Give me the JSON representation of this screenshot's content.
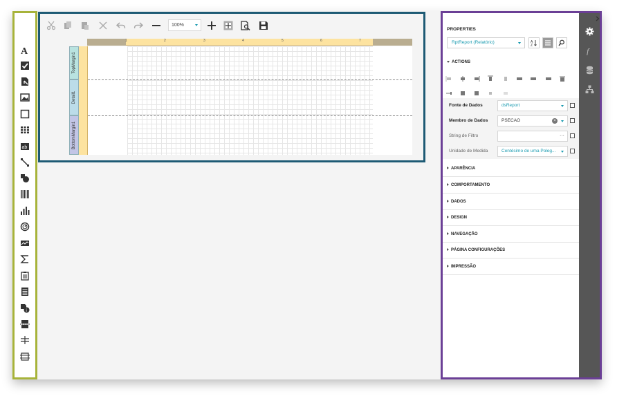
{
  "colors": {
    "toolbox_border": "#a7b33a",
    "surface_border": "#1d5a74",
    "props_border": "#6b3f96",
    "accent": "#1a9bb0",
    "ruler": "#fde3a0",
    "side_tabs": "#565656"
  },
  "toolbox": {
    "items": [
      {
        "icon": "label-icon"
      },
      {
        "icon": "checkbox-icon"
      },
      {
        "icon": "rich-text-icon"
      },
      {
        "icon": "picture-box-icon"
      },
      {
        "icon": "panel-icon"
      },
      {
        "icon": "table-icon"
      },
      {
        "icon": "character-comb-icon"
      },
      {
        "icon": "line-icon"
      },
      {
        "icon": "shape-icon"
      },
      {
        "icon": "barcode-icon"
      },
      {
        "icon": "chart-icon"
      },
      {
        "icon": "gauge-icon"
      },
      {
        "icon": "sparkline-icon"
      },
      {
        "icon": "sum-icon"
      },
      {
        "icon": "subreport-icon"
      },
      {
        "icon": "pivot-grid-icon"
      },
      {
        "icon": "page-info-icon"
      },
      {
        "icon": "page-break-icon"
      },
      {
        "icon": "cross-band-line-icon"
      },
      {
        "icon": "cross-band-box-icon"
      }
    ]
  },
  "surface": {
    "toolbar": {
      "zoom_value": "100%",
      "buttons": [
        "cut-icon",
        "copy-icon",
        "paste-icon",
        "delete-icon",
        "undo-icon",
        "redo-icon",
        "zoom-out-icon",
        "zoom-in-icon",
        "fit-page-icon",
        "preview-icon",
        "save-icon"
      ]
    },
    "ruler_numbers": [
      "1",
      "2",
      "3",
      "4",
      "5",
      "6",
      "7"
    ],
    "bands": [
      {
        "name": "TopMargin1"
      },
      {
        "name": "Detail1"
      },
      {
        "name": "BottomMargin1"
      }
    ]
  },
  "properties": {
    "title": "PROPERTIES",
    "object_selector": "RptReport (Relatório)",
    "actions_title": "ACTIONS",
    "fields": [
      {
        "label": "Fonte de Dados",
        "value": "dsReport",
        "kind": "select-link"
      },
      {
        "label": "Membro de Dados",
        "value": "PSECAO",
        "kind": "select-clear"
      },
      {
        "label": "String de Filtro",
        "value": "",
        "kind": "ellipsis"
      },
      {
        "label": "Unidade de Medida",
        "value": "Centésimo de uma Poleg...",
        "kind": "select-link"
      }
    ],
    "sections": [
      "APARÊNCIA",
      "COMPORTAMENTO",
      "DADOS",
      "DESIGN",
      "NAVEGAÇÃO",
      "PÁGINA CONFIGURAÇÕES",
      "IMPRESSÃO"
    ],
    "side_tabs": [
      "gear-icon",
      "function-icon",
      "database-icon",
      "tree-icon"
    ]
  }
}
